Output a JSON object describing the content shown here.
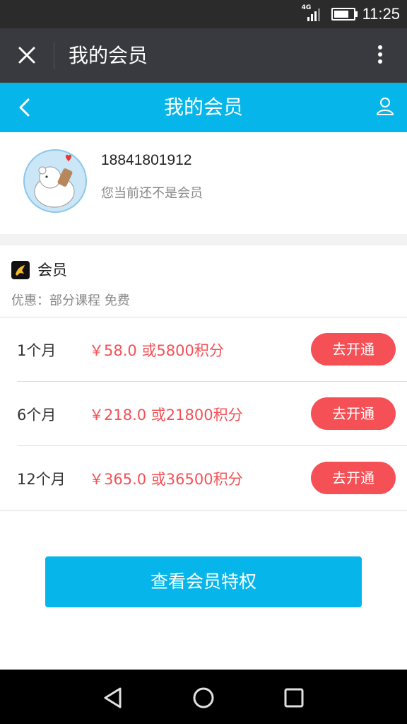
{
  "status_bar": {
    "network": "4G",
    "time": "11:25"
  },
  "title_bar": {
    "title": "我的会员"
  },
  "header": {
    "title": "我的会员"
  },
  "profile": {
    "phone": "18841801912",
    "status": "您当前还不是会员"
  },
  "membership": {
    "title": "会员",
    "benefit": "优惠：部分课程 免费",
    "plans": [
      {
        "term": "1个月",
        "price": "￥58.0 或5800积分",
        "action": "去开通"
      },
      {
        "term": "6个月",
        "price": "￥218.0 或21800积分",
        "action": "去开通"
      },
      {
        "term": "12个月",
        "price": "￥365.0 或36500积分",
        "action": "去开通"
      }
    ]
  },
  "cta": {
    "label": "查看会员特权"
  },
  "colors": {
    "accent": "#06b6ea",
    "price": "#f55056",
    "titlebar": "#393a3f"
  },
  "icons": [
    "close-icon",
    "more-icon",
    "back-icon",
    "user-icon",
    "membership-icon",
    "nav-back-icon",
    "nav-home-icon",
    "nav-recents-icon"
  ]
}
